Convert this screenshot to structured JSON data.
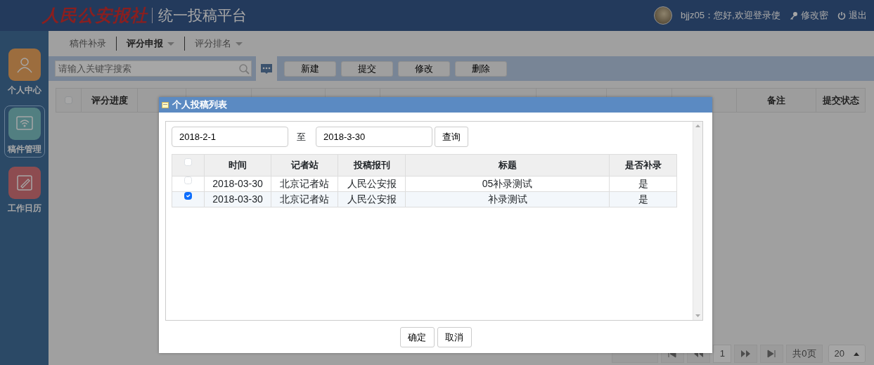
{
  "header": {
    "logo": "人民公安报社",
    "title": "统一投稿平台",
    "greeting": "bjjz05：您好,欢迎登录使",
    "links": [
      {
        "kind": "key",
        "label": "修改密"
      },
      {
        "kind": "power",
        "label": "退出"
      }
    ]
  },
  "sidebar": {
    "items": [
      {
        "kind": "user",
        "label": "个人中心",
        "selected": false
      },
      {
        "kind": "wifi",
        "label": "稿件管理",
        "selected": true
      },
      {
        "kind": "edit",
        "label": "工作日历",
        "selected": false
      }
    ]
  },
  "tabs": [
    {
      "label": "稿件补录",
      "selected": false,
      "dropdown": false
    },
    {
      "label": "评分申报",
      "selected": true,
      "dropdown": true
    },
    {
      "label": "评分排名",
      "selected": false,
      "dropdown": true
    }
  ],
  "toolbar": {
    "search": {
      "placeholder": "请输入关键字搜索"
    },
    "buttons": [
      "新建",
      "提交",
      "修改",
      "删除"
    ]
  },
  "table": {
    "all_checked": false,
    "columns": [
      "评分进度",
      "备注",
      "提交状态"
    ]
  },
  "pager": {
    "page": "1",
    "pages": "共0页",
    "size": "20"
  },
  "dialog": {
    "title": "个人投稿列表",
    "from": "2018-2-1",
    "to_label": "至",
    "to": "2018-3-30",
    "query": "查询",
    "all_checked": false,
    "columns": [
      "时间",
      "记者站",
      "投稿报刊",
      "标题",
      "是否补录"
    ],
    "rows": [
      {
        "checked": false,
        "cells": [
          "2018-03-30",
          "北京记者站",
          "人民公安报",
          "05补录测试",
          "是"
        ]
      },
      {
        "checked": true,
        "cells": [
          "2018-03-30",
          "北京记者站",
          "人民公安报",
          "补录测试",
          "是"
        ]
      }
    ],
    "buttons": [
      "确定",
      "取消"
    ]
  }
}
